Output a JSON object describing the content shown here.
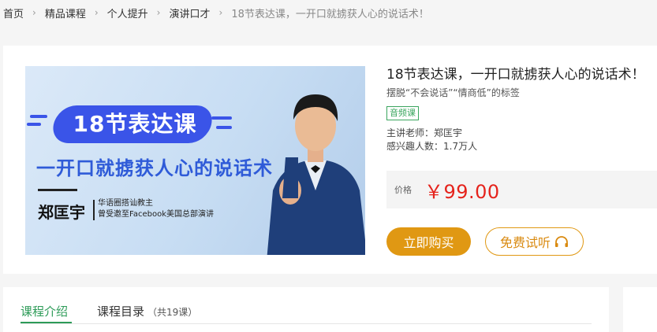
{
  "breadcrumb": [
    {
      "label": "首页"
    },
    {
      "label": "精品课程"
    },
    {
      "label": "个人提升"
    },
    {
      "label": "演讲口才"
    },
    {
      "label": "18节表达课，一开口就掳获人心的说话术！"
    }
  ],
  "cover": {
    "title": "18节表达课",
    "subtitle": "一开口就掳获人心的说话术",
    "teacher_name": "郑匡宇",
    "desc_line1": "华语圈搭讪教主",
    "desc_line2": "曾受邀至Facebook美国总部演讲"
  },
  "course": {
    "title": "18节表达课，一开口就掳获人心的说话术！",
    "subtitle": "摆脱“不会说话”“情商低”的标签",
    "badge": "音频课",
    "teacher": "主讲老师：郑匡宇",
    "interest": "感兴趣人数：1.7万人"
  },
  "price": {
    "label": "价格",
    "value": "￥99.00"
  },
  "buttons": {
    "buy": "立即购买",
    "trial": "免费试听",
    "trial_icon": "headphones-icon"
  },
  "tabs": {
    "intro": "课程介绍",
    "catalog": "课程目录",
    "catalog_count": "（共19课）"
  },
  "colors": {
    "accent_green": "#2d9b58",
    "buy_orange": "#e09813",
    "price_red": "#e5231c",
    "cover_blue": "#3a54e8"
  }
}
